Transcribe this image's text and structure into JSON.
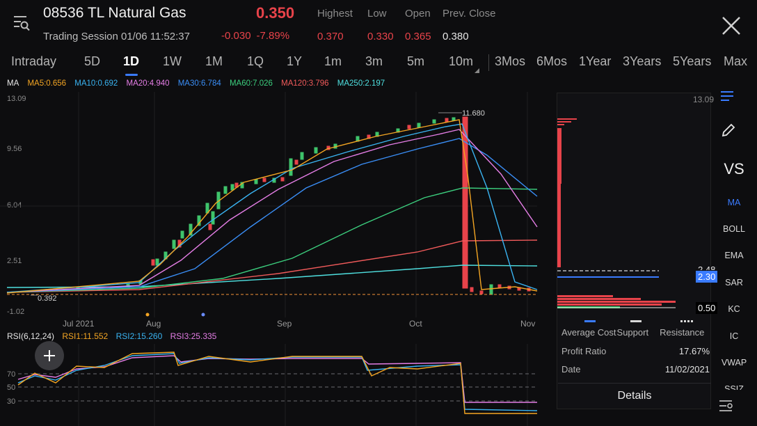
{
  "header": {
    "title": "08536 TL Natural Gas",
    "price": "0.350",
    "session": "Trading Session 01/06 11:52:37",
    "change": "-0.030",
    "change_pct": "-7.89%",
    "stats": [
      {
        "label": "Highest",
        "value": "0.370"
      },
      {
        "label": "Low",
        "value": "0.330"
      },
      {
        "label": "Open",
        "value": "0.365"
      },
      {
        "label": "Prev. Close",
        "value": "0.380"
      }
    ]
  },
  "tabs": [
    "Intraday",
    "5D",
    "1D",
    "1W",
    "1M",
    "1Q",
    "1Y",
    "1m",
    "3m",
    "5m",
    "10m",
    "3Mos",
    "6Mos",
    "1Year",
    "3Years",
    "5Years",
    "Max"
  ],
  "active_tab": "1D",
  "ma_legend": [
    {
      "label": "MA",
      "color": "#e6e6e6"
    },
    {
      "label": "MA5:0.656",
      "color": "#f5a623"
    },
    {
      "label": "MA10:0.692",
      "color": "#3ab4f2"
    },
    {
      "label": "MA20:4.940",
      "color": "#e57ee6"
    },
    {
      "label": "MA30:6.784",
      "color": "#3a8ef6"
    },
    {
      "label": "MA60:7.026",
      "color": "#3ccf7e"
    },
    {
      "label": "MA120:3.796",
      "color": "#f05a5a"
    },
    {
      "label": "MA250:2.197",
      "color": "#4fe0e0"
    }
  ],
  "y_axis": [
    "13.09",
    "9.56",
    "6.04",
    "2.51",
    "-1.02"
  ],
  "x_axis": [
    "Jul 2021",
    "Aug",
    "Sep",
    "Oct",
    "Nov"
  ],
  "annotations": {
    "high": "11.680",
    "low": "0.392"
  },
  "rsi_legend": [
    {
      "label": "RSI(6,12,24)",
      "color": "#e6e6e6"
    },
    {
      "label": "RSI1:11.552",
      "color": "#f5a623"
    },
    {
      "label": "RSI2:15.260",
      "color": "#3ab4f2"
    },
    {
      "label": "RSI3:25.335",
      "color": "#e57ee6"
    }
  ],
  "rsi_levels": [
    "70",
    "50",
    "30"
  ],
  "panel": {
    "price_top": "13.09",
    "tag_248": "2.48",
    "tag_230": "2.30",
    "tag_050": "0.50",
    "legend": {
      "avg": "Average Cost",
      "support": "Support",
      "resistance": "Resistance"
    },
    "profit_label": "Profit Ratio",
    "profit_value": "17.67%",
    "date_label": "Date",
    "date_value": "11/02/2021",
    "details": "Details"
  },
  "side": {
    "vs": "VS",
    "items": [
      "MA",
      "BOLL",
      "EMA",
      "SAR",
      "KC",
      "IC",
      "VWAP",
      "SSIZ"
    ],
    "active": "MA"
  },
  "colors": {
    "up": "#3fc46b",
    "down": "#e8434a",
    "accent": "#3a7bff"
  }
}
